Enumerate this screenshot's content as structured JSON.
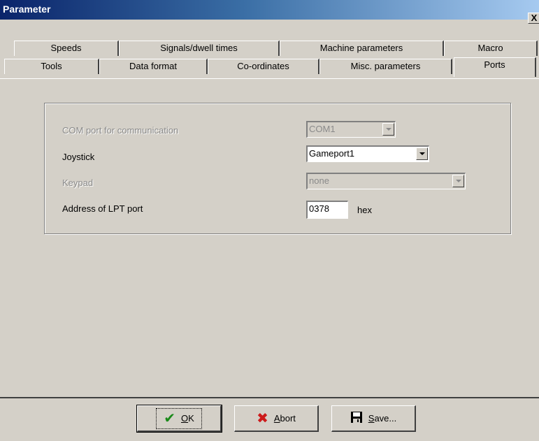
{
  "window": {
    "title": "Parameter",
    "close_label": "X"
  },
  "tabs_row1": [
    {
      "label": "Speeds"
    },
    {
      "label": "Signals/dwell times"
    },
    {
      "label": "Machine parameters"
    },
    {
      "label": "Macro"
    }
  ],
  "tabs_row2": [
    {
      "label": "Tools"
    },
    {
      "label": "Data format"
    },
    {
      "label": "Co-ordinates"
    },
    {
      "label": "Misc. parameters"
    },
    {
      "label": "Ports",
      "active": true
    }
  ],
  "ports": {
    "com_label": "COM port for communication",
    "com_value": "COM1",
    "joystick_label": "Joystick",
    "joystick_value": "Gameport1",
    "keypad_label": "Keypad",
    "keypad_value": "none",
    "lpt_label": "Address of LPT port",
    "lpt_value": "0378",
    "lpt_unit": "hex"
  },
  "buttons": {
    "ok_hotkey": "O",
    "ok_rest": "K",
    "abort_hotkey": "A",
    "abort_rest": "bort",
    "save_hotkey": "S",
    "save_rest": "ave..."
  },
  "colors": {
    "ok_icon": "#1a8a1a",
    "abort_icon": "#cc1a1a",
    "title_gradient_start": "#0a246a"
  }
}
